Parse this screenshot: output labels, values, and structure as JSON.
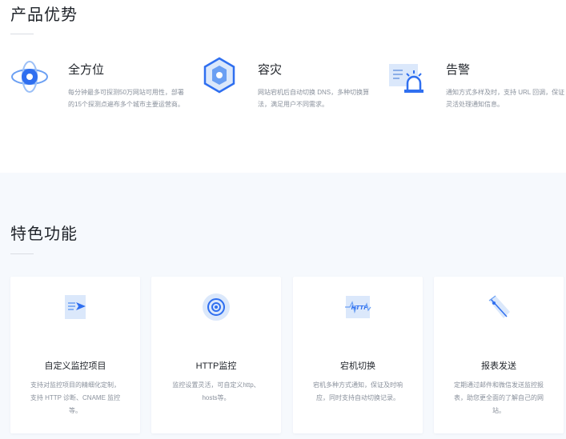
{
  "advantages": {
    "title": "产品优势",
    "items": [
      {
        "title": "全方位",
        "desc": "每分钟最多可探测50万网站可用性，部署的15个探测点遍布多个城市主要运营商。",
        "icon": "orbit-icon"
      },
      {
        "title": "容灾",
        "desc": "网站宕机后自动切换 DNS，多种切换算法，满足用户不同需求。",
        "icon": "hexagon-icon"
      },
      {
        "title": "告警",
        "desc": "通知方式多样及时，支持 URL 回调，保证灵活处理通知信息。",
        "icon": "alarm-icon"
      }
    ]
  },
  "features": {
    "title": "特色功能",
    "items": [
      {
        "title": "自定义监控项目",
        "desc": "支持对监控项目的精细化定制，支持 HTTP 诊断、CNAME 监控等。",
        "icon": "send-doc-icon"
      },
      {
        "title": "HTTP监控",
        "desc": "监控设置灵活，可自定义http、hosts等。",
        "icon": "target-icon"
      },
      {
        "title": "宕机切换",
        "desc": "宕机多种方式通知，保证及时响应，同时支持自动切换记录。",
        "icon": "http-icon"
      },
      {
        "title": "报表发送",
        "desc": "定期通过邮件和微信发送监控报表，助您更全面的了解自己的网站。",
        "icon": "report-icon"
      }
    ]
  },
  "colors": {
    "accent": "#2f6ff0",
    "light_accent": "#dbe8fb",
    "band": "#f6f9fd"
  }
}
